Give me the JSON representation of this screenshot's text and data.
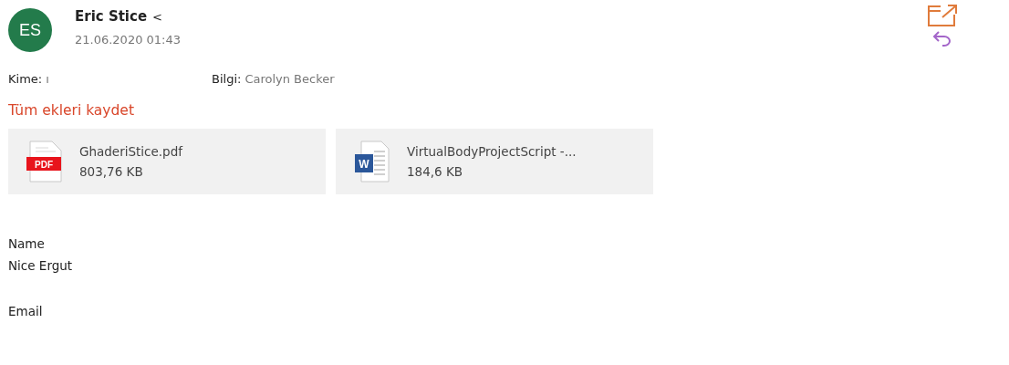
{
  "sender": {
    "initials": "ES",
    "name": "Eric Stice",
    "name_suffix": "<",
    "date": "21.06.2020 01:43"
  },
  "recipients": {
    "to_label": "Kime:",
    "to_value": "ı",
    "cc_label": "Bilgi:",
    "cc_value": "Carolyn Becker"
  },
  "save_all_link": "Tüm ekleri kaydet",
  "attachments": [
    {
      "kind": "pdf",
      "icon_text": "PDF",
      "name": "GhaderiStice.pdf",
      "size": "803,76 KB"
    },
    {
      "kind": "word",
      "icon_text": "W",
      "name": "VirtualBodyProjectScript -...",
      "size": "184,6 KB"
    }
  ],
  "body": [
    [
      "Name",
      "Nice Ergut"
    ],
    [
      "Email"
    ]
  ]
}
